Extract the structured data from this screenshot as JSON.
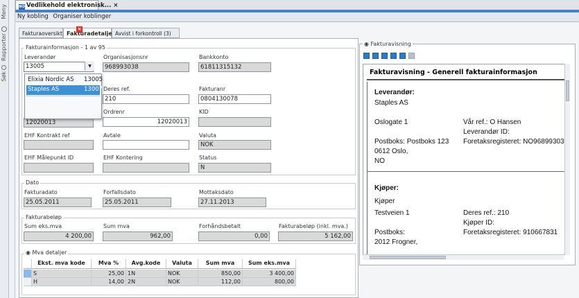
{
  "side_rail": {
    "meny": "Meny",
    "rapporter": "Rapporter",
    "sok": "Søk"
  },
  "doc_tab": {
    "icon": "NO",
    "title": "Vedlikehold elektronisk...",
    "close": "×"
  },
  "menu": [
    "Ny kobling",
    "Organiser koblinger"
  ],
  "tabs": [
    {
      "label": "Fakturaoversikt"
    },
    {
      "label": "Fakturadetaljer",
      "selected": true
    },
    {
      "label": "Avvist i forkontroll (3)"
    }
  ],
  "invoice_info": {
    "legend": "Fakturainformasjon - 1 av 95",
    "leverandor": {
      "label": "Leverandør",
      "value": "13005"
    },
    "orgnr": {
      "label": "Organisasjonsnr",
      "value": "968993038"
    },
    "bankkonto": {
      "label": "Bankkonto",
      "value": "61811315132"
    },
    "deres_ref": {
      "label": "Deres ref.",
      "value": "210"
    },
    "fakturanr": {
      "label": "Fakturanr",
      "value": "0804130078"
    },
    "ordrenr": {
      "label": "Ordrenr",
      "value": "12020013"
    },
    "ordre_left": "12020013",
    "kid": {
      "label": "KID",
      "value": ""
    },
    "ehf_kontrakt": {
      "label": "EHF Kontrakt ref",
      "value": ""
    },
    "avtale": {
      "label": "Avtale",
      "value": ""
    },
    "valuta": {
      "label": "Valuta",
      "value": "NOK"
    },
    "ehf_malepunkt": {
      "label": "EHF Målepunkt ID",
      "value": ""
    },
    "ehf_kontering": {
      "label": "EHF Kontering",
      "value": ""
    },
    "status": {
      "label": "Status",
      "value": "N"
    }
  },
  "supplier_popup": {
    "items": [
      {
        "name": "Elixia Nordic AS",
        "code": "13005",
        "selected": false
      },
      {
        "name": "Staples AS",
        "code": "13007",
        "selected": true
      }
    ]
  },
  "dato": {
    "legend": "Dato",
    "fakturadato": {
      "label": "Fakturadato",
      "value": "25.05.2011"
    },
    "forfallsdato": {
      "label": "Forfallsdato",
      "value": "25.05.2011"
    },
    "mottaksdato": {
      "label": "Mottaksdato",
      "value": "27.11.2013"
    }
  },
  "belop": {
    "legend": "Fakturabeløp",
    "sum_eks": {
      "label": "Sum eks.mva",
      "value": "4 200,00"
    },
    "sum_mva": {
      "label": "Sum mva",
      "value": "962,00"
    },
    "forhand": {
      "label": "Forhåndsbetalt",
      "value": "0,00"
    },
    "total": {
      "label": "Fakturabeløp (inkl. mva.)",
      "value": "5 162,00"
    }
  },
  "mva": {
    "legend": "Mva detaljer",
    "headers": [
      "Ekst. mva kode",
      "Mva %",
      "Avg.kode",
      "Valuta",
      "Sum mva",
      "Sum eks.mva"
    ],
    "rows": [
      [
        "S",
        "25,00",
        "1N",
        "NOK",
        "850,00",
        "3 400,00"
      ],
      [
        "H",
        "14,00",
        "2N",
        "NOK",
        "112,00",
        "800,00"
      ]
    ]
  },
  "preview": {
    "legend": "Fakturavisning",
    "title": "Fakturavisning - Generell fakturainformasjon",
    "leverandor_heading": "Leverandør:",
    "leverandor_name": "Staples AS",
    "address1": "Oslogate 1",
    "var_ref": "Vår ref.: O Hansen",
    "leverandor_id": "Leverandør ID:",
    "postboks": "Postboks: Postboks 123",
    "foretak": "Foretaksregisteret: NO968993038",
    "postnr": "0612 Oslo,",
    "land": "NO",
    "kjoper_heading": "Kjøper:",
    "kjoper_name": "Kjøper",
    "kjoper_addr": "Testveien 1",
    "deres_ref": "Deres ref.: 210",
    "kjoper_id": "Kjøper ID:",
    "kjoper_postboks": "Postboks:",
    "kjoper_foretak": "Foretaksregisteret: 910667831",
    "kjoper_postnr": "2012 Frogner,"
  }
}
